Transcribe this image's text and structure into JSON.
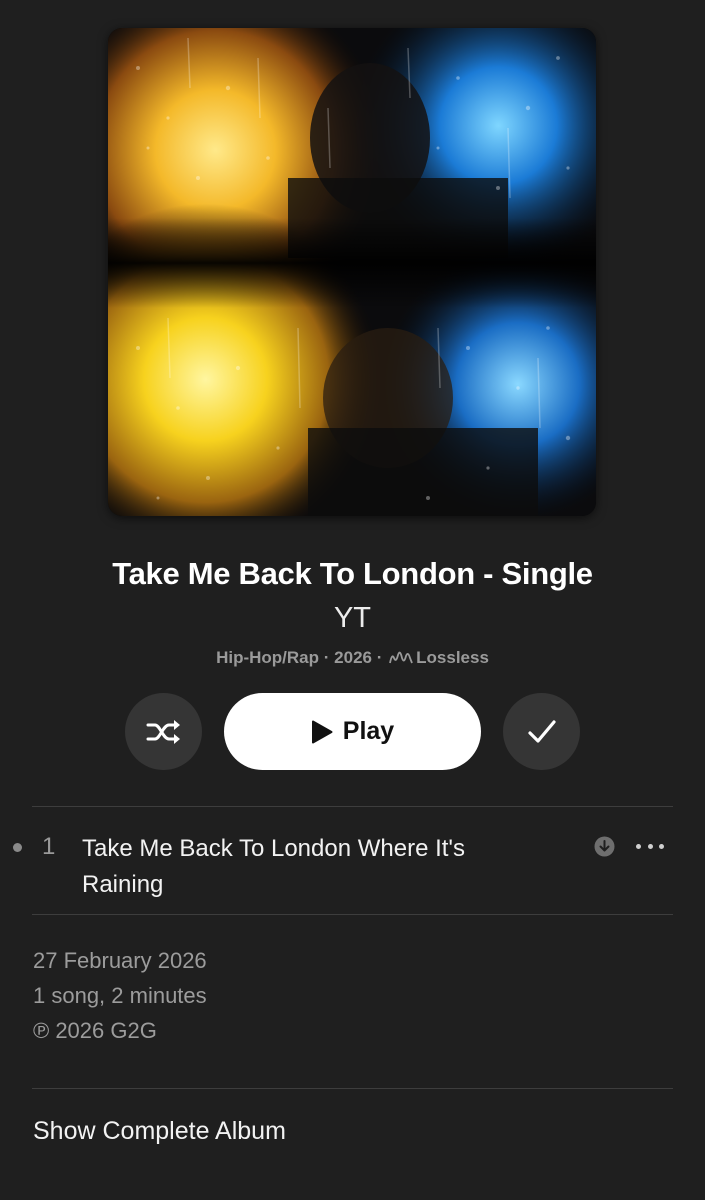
{
  "album": {
    "title": "Take Me Back To London - Single",
    "artist": "YT",
    "genre": "Hip-Hop/Rap",
    "year": "2026",
    "separator": "·",
    "quality": "Lossless"
  },
  "controls": {
    "play_label": "Play",
    "shuffle_icon": "shuffle-icon",
    "added_icon": "checkmark-icon"
  },
  "tracks": [
    {
      "number": "1",
      "title": "Take Me Back To London Where It's Raining",
      "download_icon": "download-icon",
      "more_icon": "ellipsis-icon"
    }
  ],
  "release": {
    "date": "27 February 2026",
    "summary": "1 song, 2 minutes",
    "copyright": "℗ 2026 G2G"
  },
  "footer": {
    "show_complete_label": "Show Complete Album"
  },
  "colors": {
    "background": "#1f1f1f",
    "button_bg": "#353535",
    "secondary_text": "#9a9a9a"
  }
}
